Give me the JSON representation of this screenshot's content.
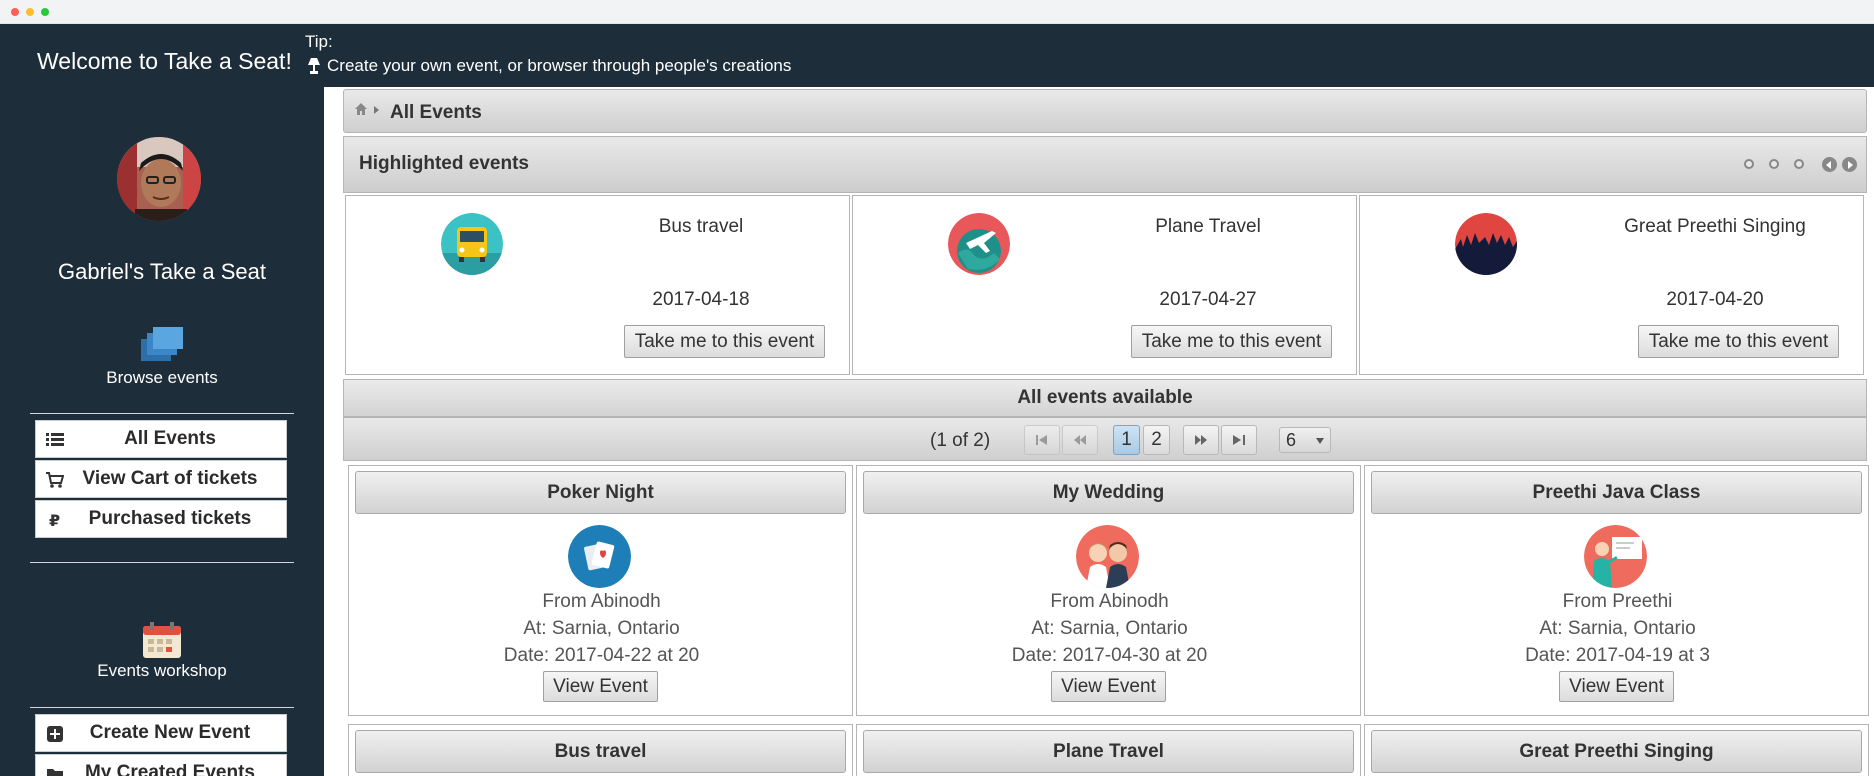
{
  "header": {
    "welcome": "Welcome to Take a Seat!",
    "tip_title": "Tip:",
    "tip_text": "Create your own event, or browser through people's creations"
  },
  "sidebar": {
    "site_name": "Gabriel's Take a Seat",
    "browse_label": "Browse events",
    "browse_items": [
      {
        "label": "All Events",
        "icon": "list-icon"
      },
      {
        "label": "View Cart of tickets",
        "icon": "cart-icon"
      },
      {
        "label": "Purchased tickets",
        "icon": "ruble-icon"
      }
    ],
    "workshop_label": "Events workshop",
    "workshop_items": [
      {
        "label": "Create New Event",
        "icon": "plus-square-icon"
      },
      {
        "label": "My Created Events",
        "icon": "folder-icon"
      }
    ]
  },
  "breadcrumb": {
    "current": "All Events"
  },
  "highlighted": {
    "title": "Highlighted events",
    "cards": [
      {
        "name": "Bus travel",
        "date": "2017-04-18",
        "button": "Take me to this event",
        "icon": "bus-icon"
      },
      {
        "name": "Plane Travel",
        "date": "2017-04-27",
        "button": "Take me to this event",
        "icon": "plane-icon"
      },
      {
        "name": "Great Preethi Singing",
        "date": "2017-04-20",
        "button": "Take me to this event",
        "icon": "concert-crowd-icon"
      }
    ]
  },
  "all_events": {
    "title": "All events available",
    "paginator": {
      "report": "(1 of 2)",
      "pages": [
        "1",
        "2"
      ],
      "current_page": "1",
      "rows_per_page": "6"
    },
    "events": [
      {
        "title": "Poker Night",
        "from": "From Abinodh",
        "at": "At: Sarnia, Ontario",
        "date": "Date: 2017-04-22 at 20",
        "button": "View Event",
        "icon": "cards-icon"
      },
      {
        "title": "My Wedding",
        "from": "From Abinodh",
        "at": "At: Sarnia, Ontario",
        "date": "Date: 2017-04-30 at 20",
        "button": "View Event",
        "icon": "wedding-couple-icon"
      },
      {
        "title": "Preethi Java Class",
        "from": "From Preethi",
        "at": "At: Sarnia, Ontario",
        "date": "Date: 2017-04-19 at 3",
        "button": "View Event",
        "icon": "teacher-icon"
      },
      {
        "title": "Bus travel"
      },
      {
        "title": "Plane Travel"
      },
      {
        "title": "Great Preethi Singing"
      }
    ]
  },
  "colors": {
    "sidebar_bg": "#1d2d3a",
    "panel_gradient_top": "#e9e9e9",
    "panel_gradient_bottom": "#cfcfcf",
    "active_page": "#a9c9e3"
  }
}
